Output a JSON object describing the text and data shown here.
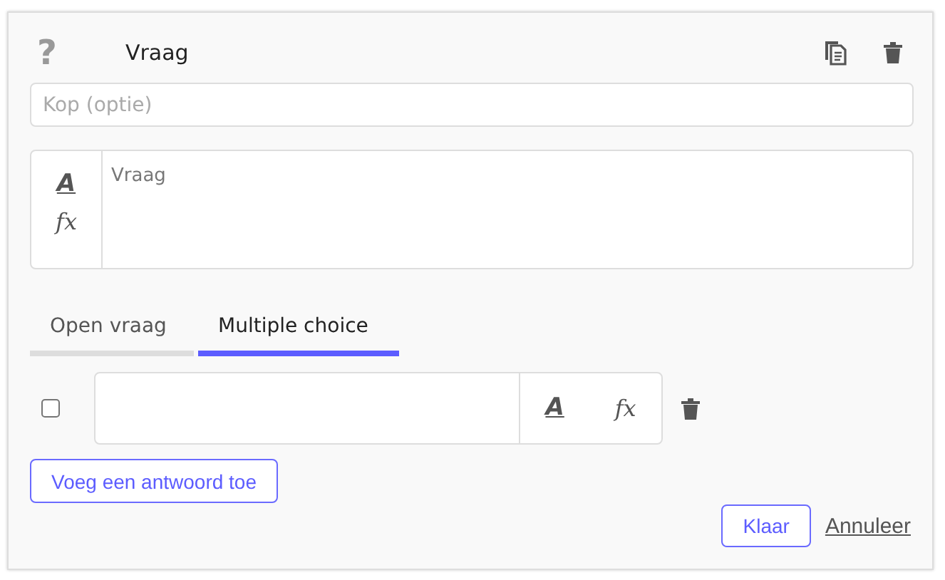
{
  "header": {
    "icon_text": "?",
    "title": "Vraag"
  },
  "heading_field": {
    "placeholder": "Kop (optie)"
  },
  "question_editor": {
    "format_symbol": "A",
    "formula_symbol": "fx",
    "placeholder": "Vraag"
  },
  "tabs": [
    {
      "label": "Open vraag",
      "selected": false
    },
    {
      "label": "Multiple choice",
      "selected": true
    }
  ],
  "answers": [
    {
      "checked": false,
      "format_symbol": "A",
      "formula_symbol": "fx"
    }
  ],
  "add_answer_button": "Voeg een antwoord toe",
  "buttons": {
    "done": "Klaar",
    "cancel": "Annuleer"
  }
}
